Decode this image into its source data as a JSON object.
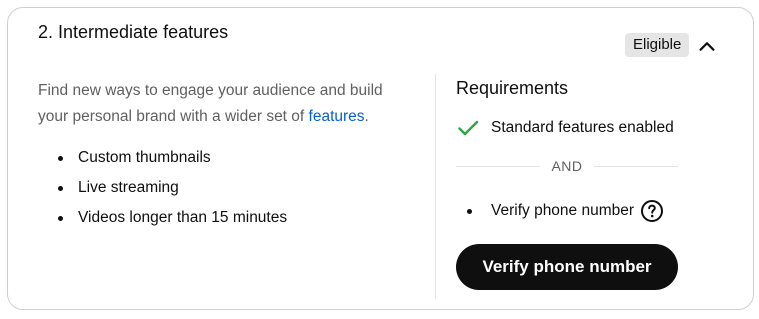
{
  "card": {
    "title": "2. Intermediate features",
    "badge": "Eligible",
    "expanded": true
  },
  "description": {
    "text": "Find new ways to engage your audience and build your personal brand with a wider set of ",
    "link": "features",
    "suffix": "."
  },
  "features": [
    "Custom thumbnails",
    "Live streaming",
    "Videos longer than 15 minutes"
  ],
  "requirements": {
    "title": "Requirements",
    "completed": "Standard features enabled",
    "separator": "AND",
    "pending": "Verify phone number",
    "button": "Verify phone number"
  },
  "colors": {
    "link": "#065fd4",
    "check": "#2ba640",
    "button_bg": "#0f0f0f",
    "badge_bg": "#e5e5e5"
  }
}
